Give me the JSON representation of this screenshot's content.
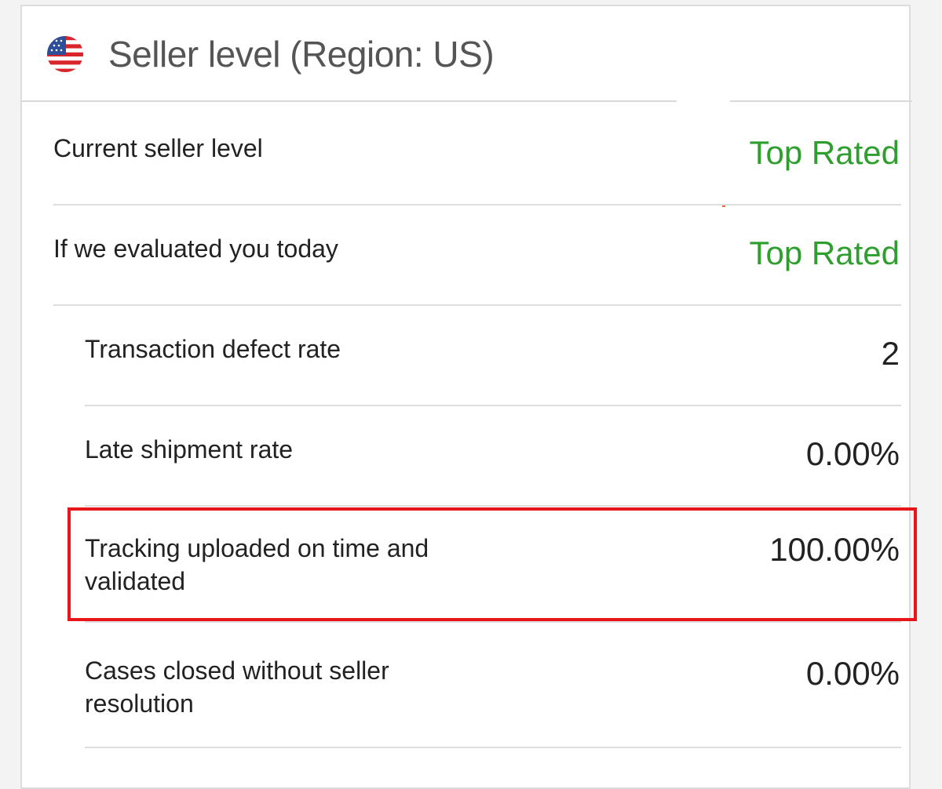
{
  "card": {
    "title": "Seller level (Region: US)",
    "flag_icon": "us-flag-icon"
  },
  "rows": [
    {
      "label": "Current seller level",
      "value": "Top Rated",
      "indent": false,
      "status": "rating"
    },
    {
      "label": "If we evaluated you today",
      "value": "Top Rated",
      "indent": false,
      "status": "rating"
    },
    {
      "label": "Transaction defect rate",
      "value": "2",
      "indent": true
    },
    {
      "label": "Late shipment rate",
      "value": "0.00%",
      "indent": true
    },
    {
      "label": "Tracking uploaded on time and validated",
      "value": "100.00%",
      "indent": true,
      "highlighted": true
    },
    {
      "label": "Cases closed without seller resolution",
      "value": "0.00%",
      "indent": true
    }
  ],
  "colors": {
    "rating_green": "#2e9e2e",
    "highlight_red": "#e8161b",
    "border_gray": "#dedede"
  }
}
